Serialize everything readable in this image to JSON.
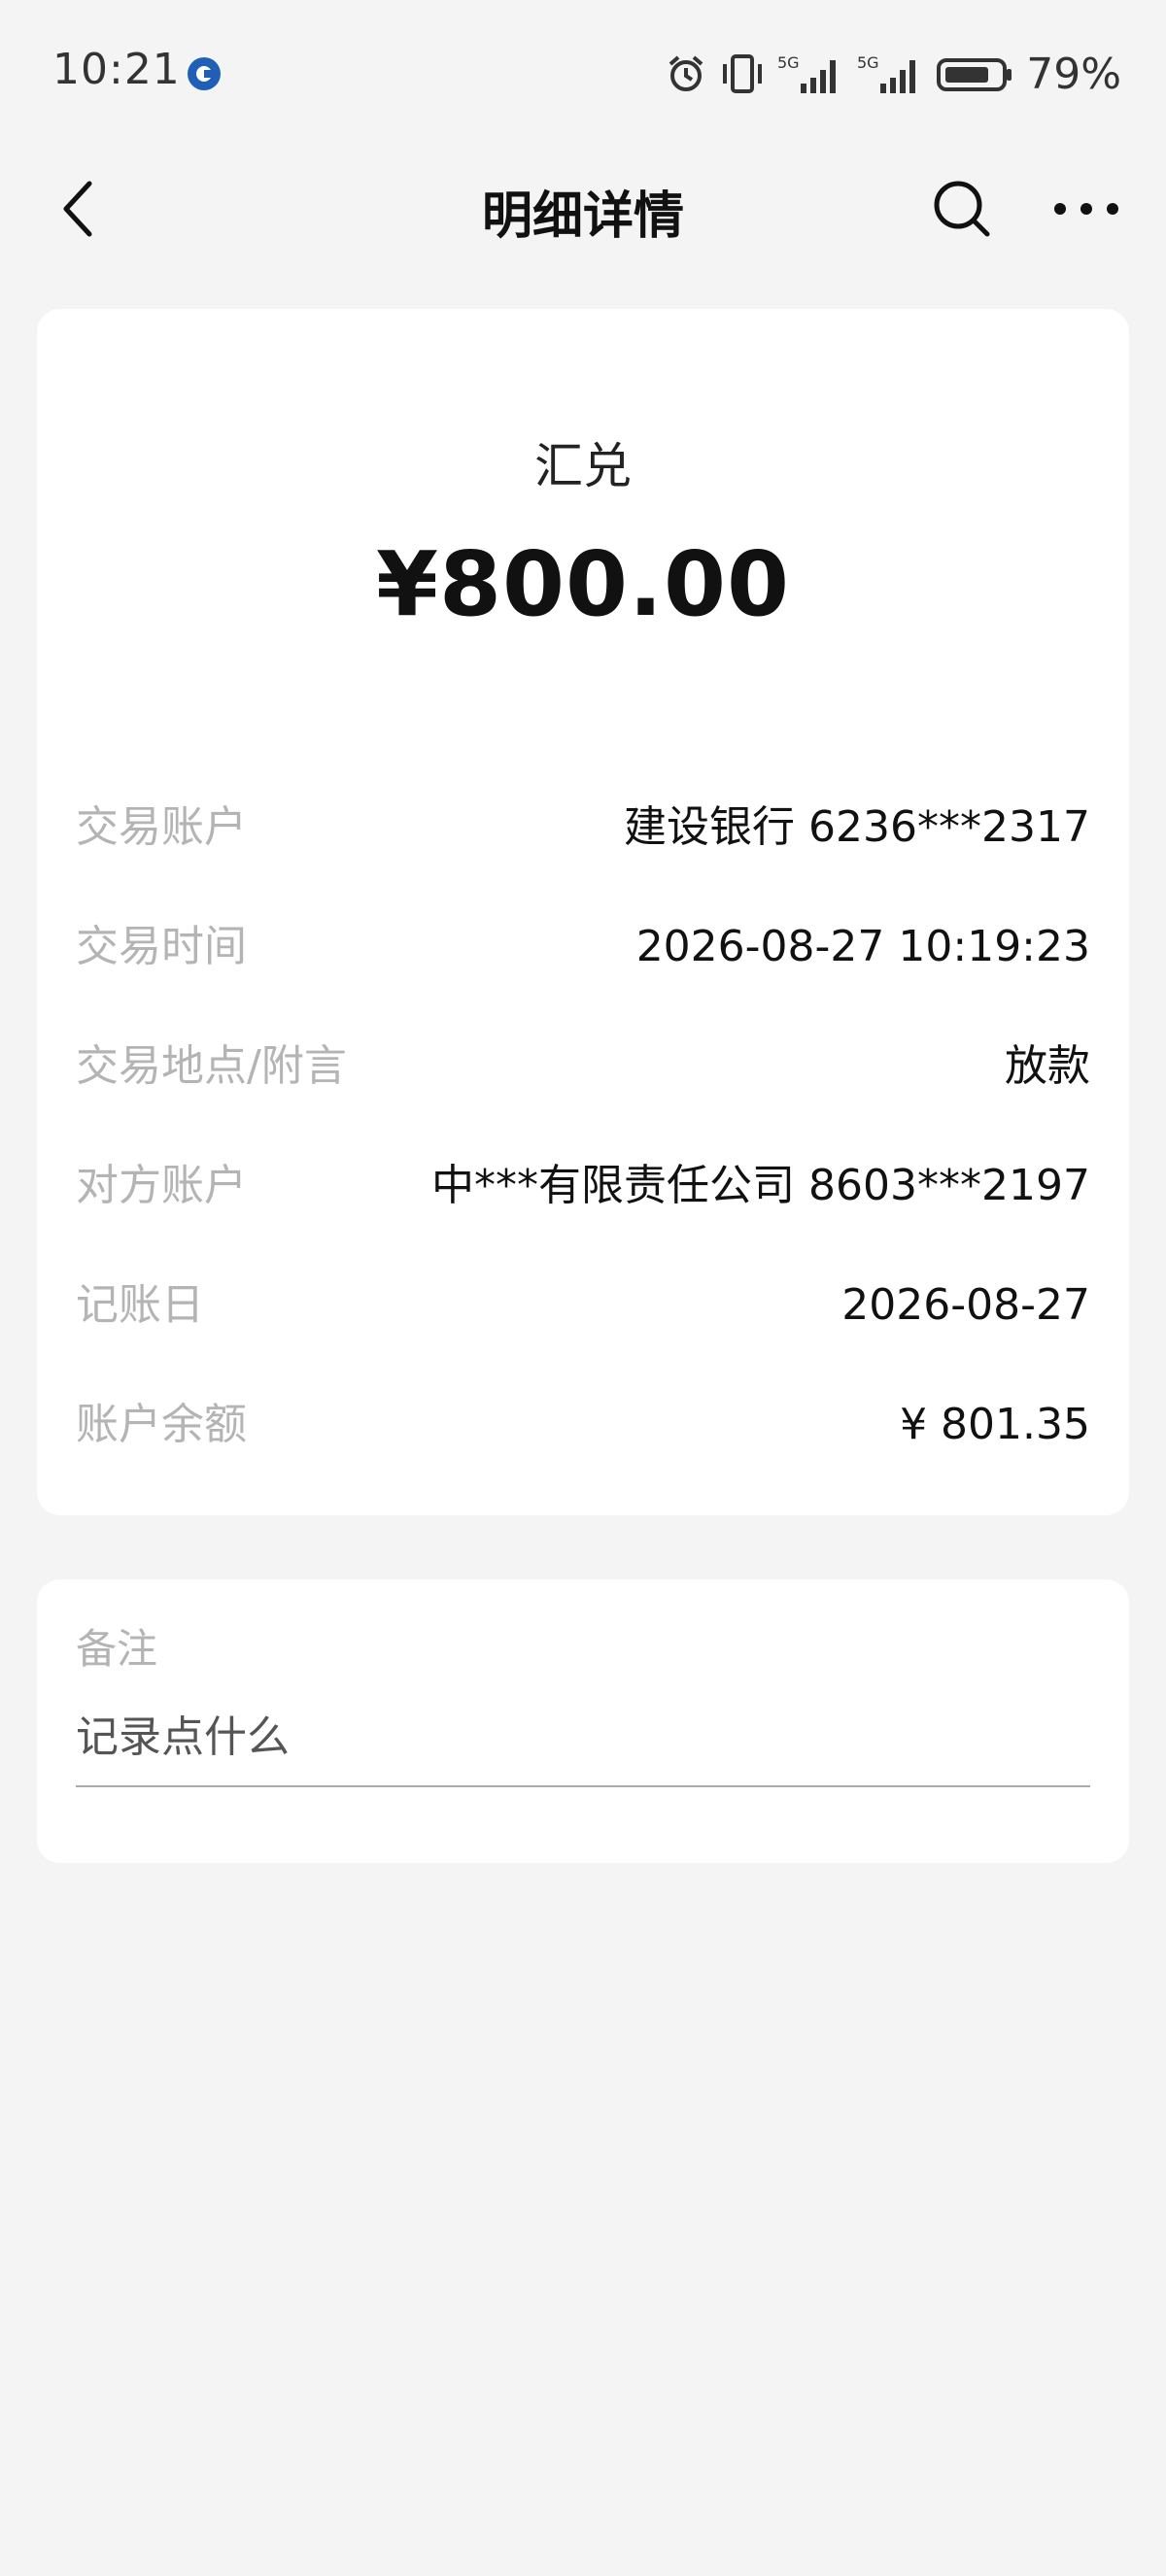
{
  "status_bar": {
    "time": "10:21",
    "battery_percent": "79%",
    "signal_1": "5G",
    "signal_2": "5G",
    "app_icon": "ccb-bank-icon"
  },
  "nav": {
    "title": "明细详情",
    "back_icon": "chevron-left-icon",
    "search_icon": "search-icon",
    "more_icon": "more-horizontal-icon"
  },
  "transaction": {
    "type": "汇兑",
    "amount": "¥800.00",
    "details": [
      {
        "label": "交易账户",
        "value": "建设银行 6236***2317"
      },
      {
        "label": "交易时间",
        "value": "2026-08-27 10:19:23"
      },
      {
        "label": "交易地点/附言",
        "value": "放款"
      },
      {
        "label": "对方账户",
        "value": "中***有限责任公司 8603***2197"
      },
      {
        "label": "记账日",
        "value": "2026-08-27"
      },
      {
        "label": "账户余额",
        "value": "¥ 801.35"
      }
    ]
  },
  "note": {
    "label": "备注",
    "placeholder": "记录点什么"
  },
  "colors": {
    "background": "#f4f4f4",
    "card": "#ffffff",
    "label_gray": "#b4b4b4",
    "text": "#111111",
    "brand_blue": "#1f5fb5"
  }
}
